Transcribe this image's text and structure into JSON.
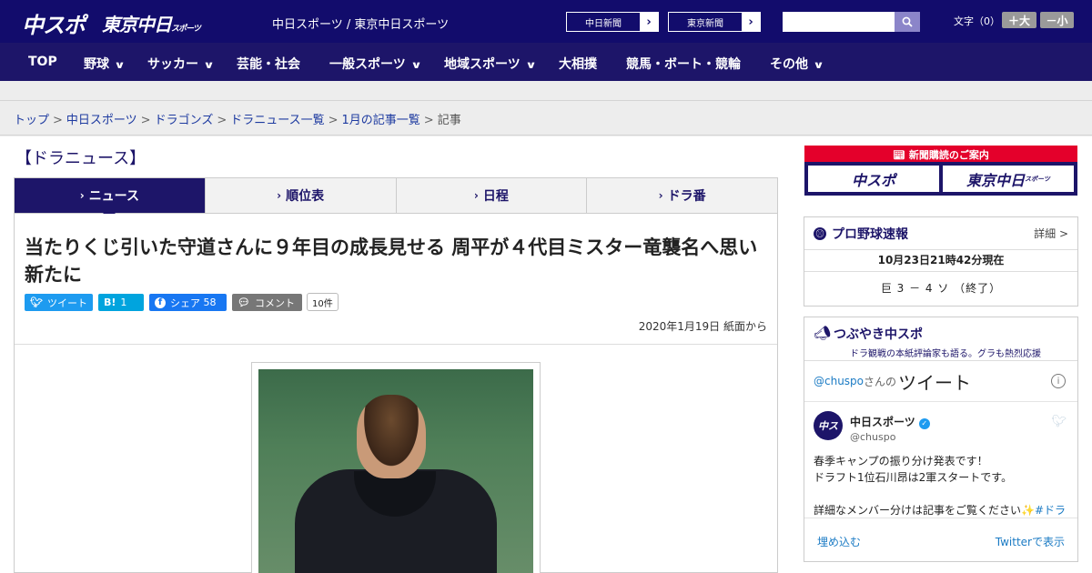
{
  "header": {
    "logo_chuspo": "中スポ",
    "logo_tokyo": "東京中日",
    "logo_tokyo_small": "スポーツ",
    "site_names": "中日スポーツ / 東京中日スポーツ",
    "link_chunichi": "中日新聞",
    "link_tokyo": "東京新聞",
    "search_placeholder": "",
    "fontsize_label": "文字（0）",
    "fontsize_plus": "＋大",
    "fontsize_minus": "－小"
  },
  "nav": {
    "items": [
      {
        "label": "TOP",
        "dropdown": false
      },
      {
        "label": "野球",
        "dropdown": true
      },
      {
        "label": "サッカー",
        "dropdown": true
      },
      {
        "label": "芸能・社会",
        "dropdown": false
      },
      {
        "label": "一般スポーツ",
        "dropdown": true
      },
      {
        "label": "地域スポーツ",
        "dropdown": true
      },
      {
        "label": "大相撲",
        "dropdown": false
      },
      {
        "label": "競馬・ボート・競輪",
        "dropdown": false
      },
      {
        "label": "その他",
        "dropdown": true
      }
    ],
    "dropdown_glyph": "∨"
  },
  "breadcrumb": {
    "items": [
      "トップ",
      "中日スポーツ",
      "ドラゴンズ",
      "ドラニュース一覧",
      "1月の記事一覧"
    ],
    "current": "記事",
    "separator": ">"
  },
  "section": {
    "title": "【ドラニュース】",
    "tabs": [
      "ニュース",
      "順位表",
      "日程",
      "ドラ番"
    ],
    "active_tab": 0
  },
  "article": {
    "headline": "当たりくじ引いた守道さんに９年目の成長見せる 周平が４代目ミスター竜襲名へ思い新たに",
    "share": {
      "tweet": "ツイート",
      "hatena": "B!",
      "hatena_count": "1",
      "facebook": "シェア",
      "facebook_count": "58",
      "comment": "コメント",
      "comment_count": "10件"
    },
    "date": "2020年1月19日 紙面から"
  },
  "sidebar": {
    "subscribe_title": "新聞購読のご案内",
    "subscribe_logo1": "中スポ",
    "subscribe_logo2": "東京中日",
    "subscribe_logo2_small": "スポーツ",
    "baseball": {
      "title": "プロ野球速報",
      "more": "詳細 >",
      "time": "10月23日21時42分現在",
      "score": "巨 3 － 4 ソ （終了）"
    },
    "twitter": {
      "title": "つぶやき中スポ",
      "subtitle": "ドラ観戦の本紙評論家も語る。グラも熱烈応援",
      "handle": "@chuspo",
      "san": "さんの",
      "tweets_word": "ツイート",
      "tweet_name": "中日スポーツ",
      "tweet_handle": "@chuspo",
      "tweet_line1": "春季キャンプの振り分け発表です！",
      "tweet_line2": "ドラフト1位石川昂は2軍スタートです。",
      "tweet_line3": "詳細なメンバー分けは記事をご覧ください",
      "tweet_tag": "#ドラ",
      "embed": "埋め込む",
      "view_on": "Twitterで表示"
    }
  },
  "colors": {
    "header": "#120c6c",
    "nav": "#1d1569",
    "subscribe_red": "#e4002b",
    "twitter_blue": "#1d9bf0",
    "hatena_blue": "#00a4de",
    "facebook_blue": "#1877f2",
    "comment_gray": "#777777"
  }
}
